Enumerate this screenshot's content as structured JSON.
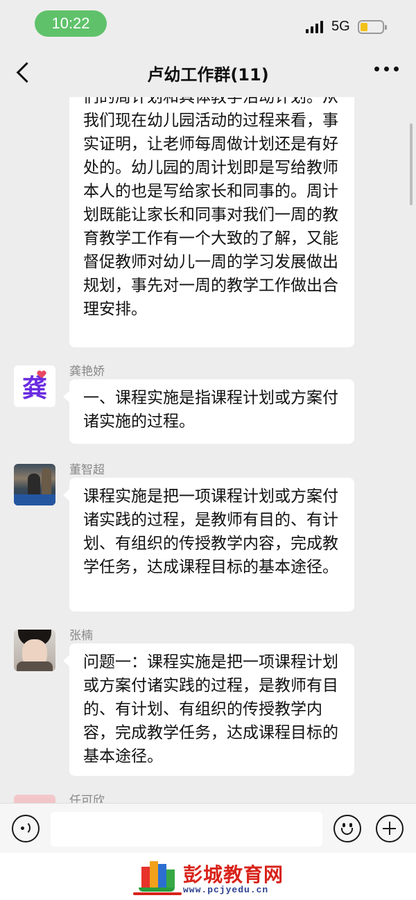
{
  "status_bar": {
    "time": "10:22",
    "network": "5G",
    "battery_level": 0.25,
    "battery_color": "#f2c21a"
  },
  "nav": {
    "title": "卢幼工作群(11)",
    "back_icon": "chevron-left-icon",
    "more_icon": "ellipsis-icon"
  },
  "messages": [
    {
      "sender": "",
      "text": "们的周计划和具体教学活动计划。从我们现在幼儿园活动的过程来看，事实证明，让老师每周做计划还是有好处的。幼儿园的周计划即是写给教师本人的也是写给家长和同事的。周计划既能让家长和同事对我们一周的教育教学工作有一个大致的了解，又能督促教师对幼儿一周的学习发展做出规划，事先对一周的教学工作做出合理安排。"
    },
    {
      "sender": "龚艳娇",
      "avatar_text": "龚",
      "text": "一、课程实施是指课程计划或方案付诸实施的过程。"
    },
    {
      "sender": "董智超",
      "text": "课程实施是把一项课程计划或方案付诸实践的过程，是教师有目的、有计划、有组织的传授教学内容，完成教学任务，达成课程目标的基本途径。"
    },
    {
      "sender": "张楠",
      "text": "问题一：课程实施是把一项课程计划或方案付诸实践的过程，是教师有目的、有计划、有组织的传授教学内容，完成教学任务，达成课程目标的基本途径。"
    },
    {
      "sender": "任可欣",
      "text": ""
    }
  ],
  "input_bar": {
    "voice_icon": "voice-icon",
    "emoji_icon": "emoji-icon",
    "plus_icon": "plus-icon",
    "placeholder": ""
  },
  "watermark": {
    "name": "彭城教育网",
    "url": "www.pcjyedu.cn"
  }
}
